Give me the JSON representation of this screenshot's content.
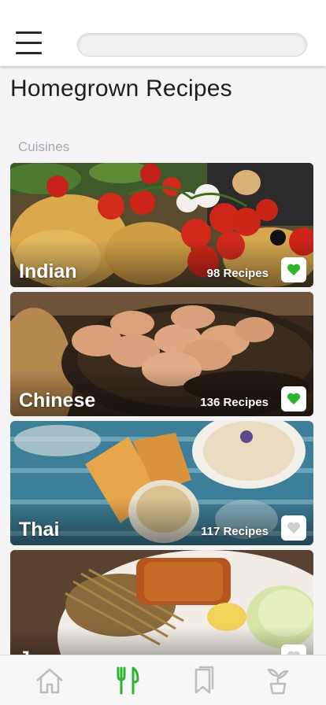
{
  "header": {
    "search": {
      "value": "",
      "placeholder": ""
    }
  },
  "page_title": "Homegrown Recipes",
  "section_label": "Cuisines",
  "cuisines": [
    {
      "name": "Indian",
      "count": "98 Recipes",
      "favorited": true
    },
    {
      "name": "Chinese",
      "count": "136 Recipes",
      "favorited": true
    },
    {
      "name": "Thai",
      "count": "117 Recipes",
      "favorited": false
    },
    {
      "name": "J",
      "count": "",
      "favorited": false
    }
  ],
  "bottom_nav": [
    {
      "icon": "home-icon",
      "active": false
    },
    {
      "icon": "fork-knife-icon",
      "active": true
    },
    {
      "icon": "bookmark-icon",
      "active": false
    },
    {
      "icon": "plant-icon",
      "active": false
    }
  ],
  "colors": {
    "accent_green": "#2bb52b",
    "heart_inactive": "#cfcfcf",
    "nav_inactive": "#bdbdbd"
  }
}
